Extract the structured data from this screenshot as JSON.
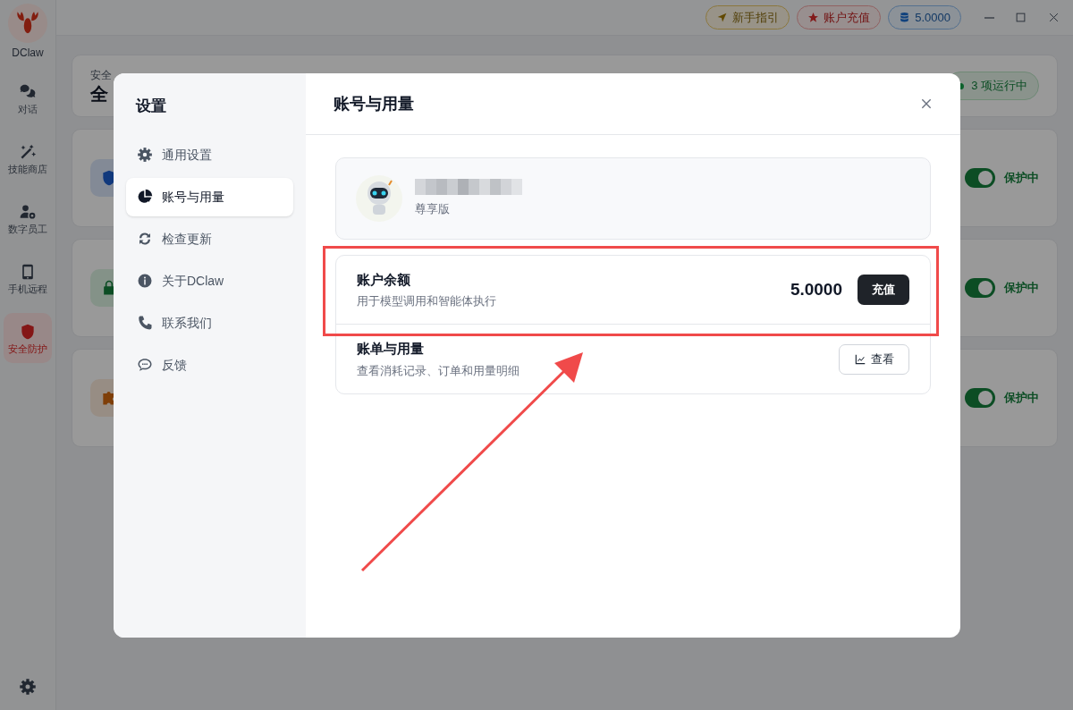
{
  "sidebar": {
    "logo_label": "DClaw",
    "items": [
      {
        "kind": "chat",
        "label": "对话",
        "selected": false
      },
      {
        "kind": "wand",
        "label": "技能商店",
        "selected": false
      },
      {
        "kind": "staff",
        "label": "数字员工",
        "selected": false
      },
      {
        "kind": "mobile",
        "label": "手机远程",
        "selected": false
      },
      {
        "kind": "shield",
        "label": "安全防护",
        "selected": true
      }
    ]
  },
  "top_bar": {
    "guide": "新手指引",
    "recharge": "账户充值",
    "balance": "5.0000"
  },
  "background": {
    "status_label": "安全",
    "status_heading": "全",
    "running_badge": "3 项运行中",
    "cards": [
      {
        "kind": "shield",
        "on": true,
        "status": "保护中"
      },
      {
        "kind": "lock",
        "on": true,
        "status": "保护中"
      },
      {
        "kind": "puzzle",
        "on": true,
        "status": "保护中"
      }
    ]
  },
  "settings": {
    "title": "设置",
    "nav": [
      {
        "kind": "gear",
        "label": "通用设置",
        "selected": false
      },
      {
        "kind": "pie",
        "label": "账号与用量",
        "selected": true
      },
      {
        "kind": "refresh",
        "label": "检查更新",
        "selected": false
      },
      {
        "kind": "info",
        "label": "关于DClaw",
        "selected": false
      },
      {
        "kind": "phone",
        "label": "联系我们",
        "selected": false
      },
      {
        "kind": "comment",
        "label": "反馈",
        "selected": false
      }
    ],
    "page_title": "账号与用量",
    "profile": {
      "tier": "尊享版"
    },
    "balance": {
      "title": "账户余额",
      "subtitle": "用于模型调用和智能体执行",
      "amount": "5.0000",
      "button": "充值"
    },
    "billing": {
      "title": "账单与用量",
      "subtitle": "查看消耗记录、订单和用量明细",
      "button": "查看"
    }
  }
}
